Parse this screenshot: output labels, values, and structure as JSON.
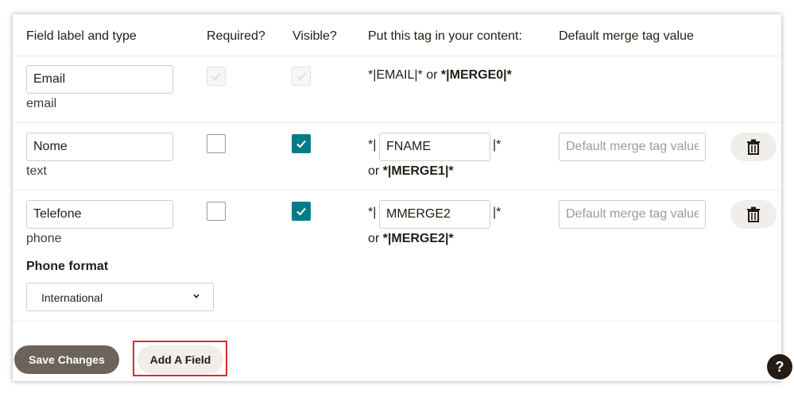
{
  "columns": {
    "field_label": "Field label and type",
    "required": "Required?",
    "visible": "Visible?",
    "tag": "Put this tag in your content:",
    "default": "Default merge tag value"
  },
  "fields": [
    {
      "label": "Email",
      "type": "email",
      "required": true,
      "visible": true,
      "locked": true,
      "tag_prefix": "*|EMAIL|* or ",
      "merge_tag": "*|MERGE0|*"
    },
    {
      "label": "Nome",
      "type": "text",
      "required": false,
      "visible": true,
      "tag_open": "*|",
      "tag_value": "FNAME",
      "tag_close": "|*",
      "or_text": "or ",
      "merge_tag": "*|MERGE1|*",
      "default_placeholder": "Default merge tag value"
    },
    {
      "label": "Telefone",
      "type": "phone",
      "required": false,
      "visible": true,
      "tag_open": "*|",
      "tag_value": "MMERGE2",
      "tag_close": "|*",
      "or_text": "or ",
      "merge_tag": "*|MERGE2|*",
      "default_placeholder": "Default merge tag value",
      "phone_format_label": "Phone format",
      "phone_format_value": "International"
    }
  ],
  "actions": {
    "save_label": "Save Changes",
    "add_label": "Add A Field",
    "help_label": "?"
  },
  "colors": {
    "checkbox_checked": "#007c89",
    "save_button": "#6b635c",
    "highlight": "#d32f2f"
  }
}
